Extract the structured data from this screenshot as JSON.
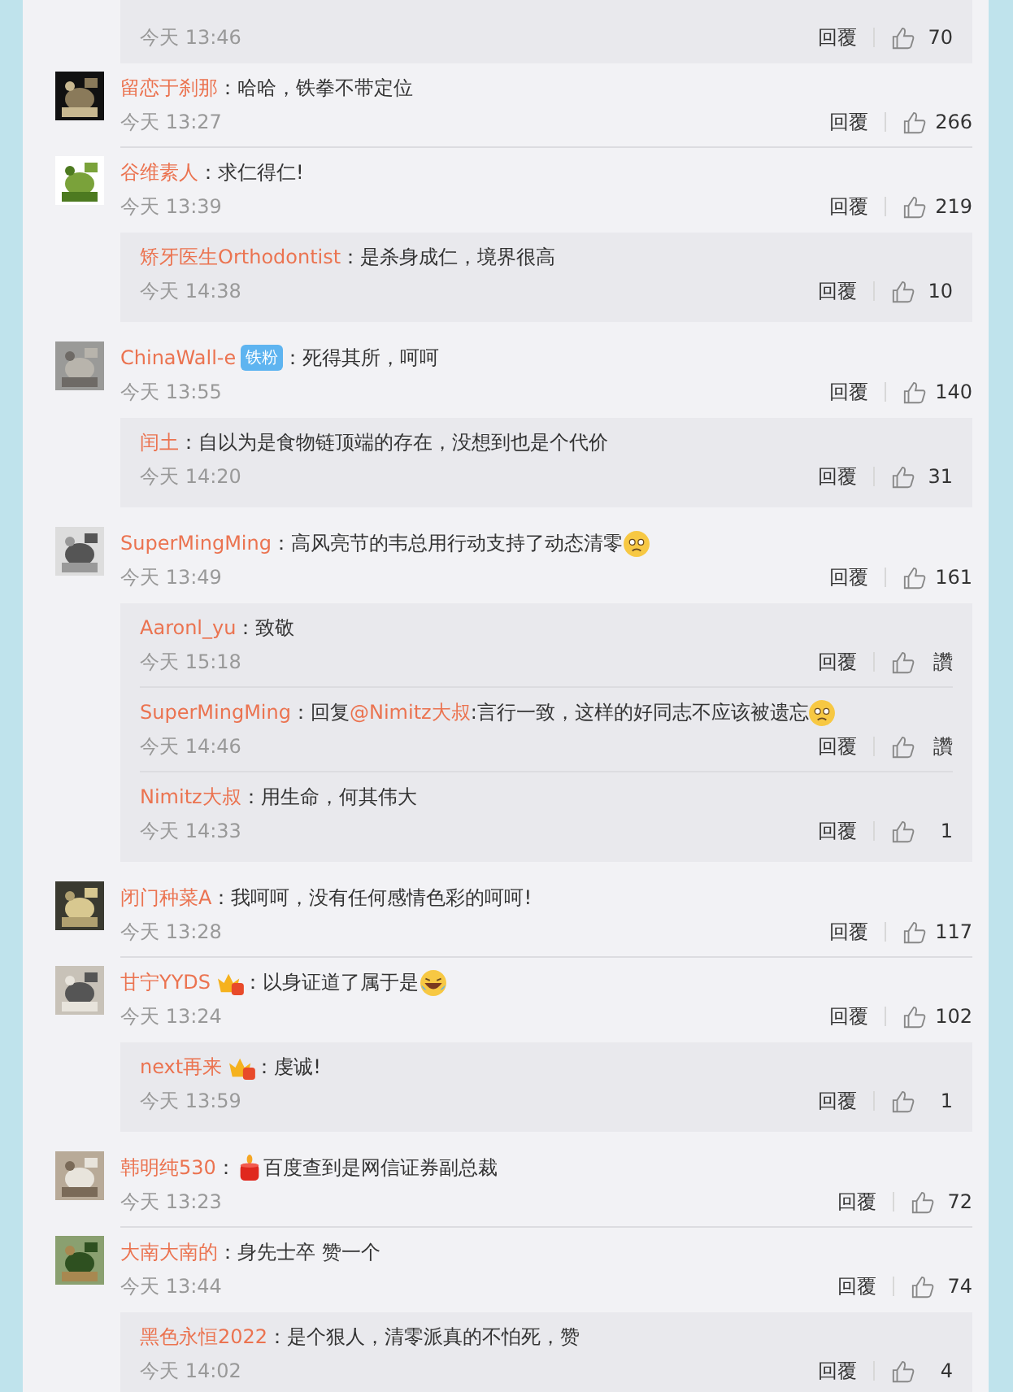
{
  "top_reply": {
    "time": "今天 13:46",
    "reply": "回覆",
    "likes": "70"
  },
  "comments": [
    {
      "name": "留恋于刹那",
      "segments": [
        {
          "kind": "text",
          "text": "：哈哈，铁拳不带定位"
        }
      ],
      "time": "今天 13:27",
      "reply": "回覆",
      "likes": "266"
    },
    {
      "name": "谷维素人",
      "segments": [
        {
          "kind": "text",
          "text": "：求仁得仁!"
        }
      ],
      "time": "今天 13:39",
      "reply": "回覆",
      "likes": "219",
      "replies": [
        {
          "name": "矫牙医生Orthodontist",
          "segments": [
            {
              "kind": "text",
              "text": "：是杀身成仁，境界很高"
            }
          ],
          "time": "今天 14:38",
          "reply": "回覆",
          "likes": "10"
        }
      ]
    },
    {
      "name": "ChinaWall-e",
      "badge": {
        "kind": "fan",
        "text": "铁粉"
      },
      "segments": [
        {
          "kind": "text",
          "text": "：死得其所，呵呵"
        }
      ],
      "time": "今天 13:55",
      "reply": "回覆",
      "likes": "140",
      "replies": [
        {
          "name": "闰土",
          "segments": [
            {
              "kind": "text",
              "text": "：自以为是食物链顶端的存在，没想到也是个代价"
            }
          ],
          "time": "今天 14:20",
          "reply": "回覆",
          "likes": "31"
        }
      ]
    },
    {
      "name": "SuperMingMing",
      "segments": [
        {
          "kind": "text",
          "text": "：高风亮节的韦总用行动支持了动态清零"
        },
        {
          "kind": "sad"
        }
      ],
      "time": "今天 13:49",
      "reply": "回覆",
      "likes": "161",
      "replies": [
        {
          "name": "Aaronl_yu",
          "segments": [
            {
              "kind": "text",
              "text": "：致敬"
            }
          ],
          "time": "今天 15:18",
          "reply": "回覆",
          "likes": "讚"
        },
        {
          "name": "SuperMingMing",
          "segments": [
            {
              "kind": "text",
              "text": "：回复"
            },
            {
              "kind": "mention",
              "text": "@Nimitz大叔"
            },
            {
              "kind": "text",
              "text": ":言行一致，这样的好同志不应该被遗忘"
            },
            {
              "kind": "sad"
            }
          ],
          "time": "今天 14:46",
          "reply": "回覆",
          "likes": "讚"
        },
        {
          "name": "Nimitz大叔",
          "segments": [
            {
              "kind": "text",
              "text": "：用生命，何其伟大"
            }
          ],
          "time": "今天 14:33",
          "reply": "回覆",
          "likes": "1"
        }
      ]
    },
    {
      "name": "闭门种菜A",
      "segments": [
        {
          "kind": "text",
          "text": "：我呵呵，没有任何感情色彩的呵呵!"
        }
      ],
      "time": "今天 13:28",
      "reply": "回覆",
      "likes": "117"
    },
    {
      "name": "甘宁YYDS",
      "badge": {
        "kind": "crown"
      },
      "segments": [
        {
          "kind": "text",
          "text": "：以身证道了属于是"
        },
        {
          "kind": "laugh"
        }
      ],
      "time": "今天 13:24",
      "reply": "回覆",
      "likes": "102",
      "replies": [
        {
          "name": "next再来",
          "badge": {
            "kind": "crown"
          },
          "segments": [
            {
              "kind": "text",
              "text": "：虔诚!"
            }
          ],
          "time": "今天 13:59",
          "reply": "回覆",
          "likes": "1"
        }
      ]
    },
    {
      "name": "韩明纯530",
      "segments": [
        {
          "kind": "text",
          "text": "："
        },
        {
          "kind": "candle"
        },
        {
          "kind": "text",
          "text": " 百度查到是网信证券副总裁"
        }
      ],
      "time": "今天 13:23",
      "reply": "回覆",
      "likes": "72"
    },
    {
      "name": "大南大南的",
      "segments": [
        {
          "kind": "text",
          "text": "：身先士卒 赞一个"
        }
      ],
      "time": "今天 13:44",
      "reply": "回覆",
      "likes": "74",
      "replies": [
        {
          "name": "黑色永恒2022",
          "segments": [
            {
              "kind": "text",
              "text": "：是个狠人，清零派真的不怕死，赞"
            }
          ],
          "time": "今天 14:02",
          "reply": "回覆",
          "likes": "4"
        }
      ]
    }
  ]
}
